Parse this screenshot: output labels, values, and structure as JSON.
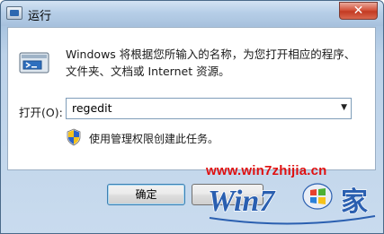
{
  "window": {
    "title": "运行",
    "close_label": "✕"
  },
  "dialog": {
    "description": "Windows 将根据您所输入的名称，为您打开相应的程序、文件夹、文档或 Internet 资源。",
    "open_label": "打开(O):",
    "open_value": "regedit",
    "admin_note": "使用管理权限创建此任务。"
  },
  "buttons": {
    "ok_label": "确定"
  },
  "watermark": {
    "url": "www.win7zhijia.cn",
    "logo_text": "Win7",
    "logo_suffix": "家"
  },
  "icons": {
    "title": "run-icon",
    "dialog": "run-icon",
    "shield": "uac-shield-icon"
  },
  "colors": {
    "watermark_red": "#e01010",
    "logo_blue": "#2a5fb0"
  }
}
